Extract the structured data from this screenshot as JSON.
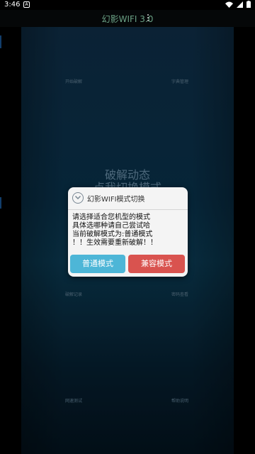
{
  "status_bar": {
    "time": "3:46",
    "notification_glyph": "A"
  },
  "app_bar": {
    "title": "幻影WIFI 3.0"
  },
  "menu": {
    "row1_left": "开始破解",
    "row1_right": "字典管理",
    "row2_left": "破解记录",
    "row2_right": "密码查看",
    "row3_left": "网速测试",
    "row3_right": "帮助说明"
  },
  "center": {
    "line1": "破解动态",
    "line2": "点我切换模式"
  },
  "dialog": {
    "title": "幻影WIFI模式切换",
    "body_lines": [
      "请选择适合您机型的模式",
      "具体选哪种请自己尝试哈",
      "当前破解模式为:普通模式",
      "！！生效需要重新破解！！"
    ],
    "normal_button": "普通模式",
    "compat_button": "兼容模式"
  },
  "colors": {
    "normal_button": "#4db6d7",
    "compat_button": "#d9534f",
    "app_title": "#6aa084",
    "panel": "#0c3e58"
  }
}
